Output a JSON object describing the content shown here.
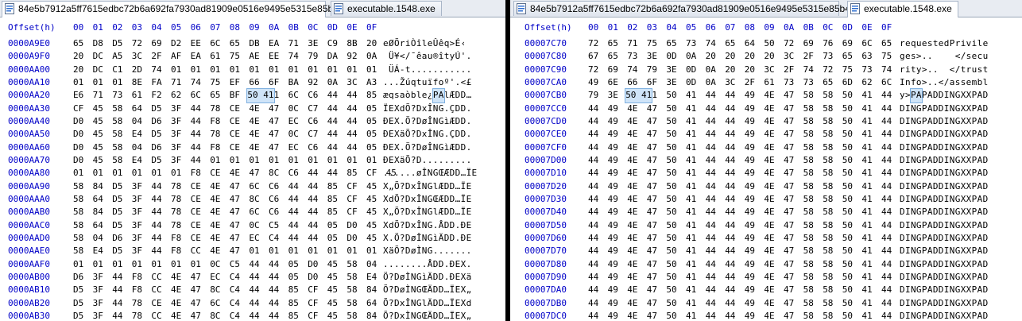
{
  "left": {
    "tabs": [
      {
        "label": "84e5b7912a5ff7615edbc72b6a692fa7930ad81909e0516e9495e5315e85b4bc",
        "icon": "hex-file-icon",
        "active": true
      },
      {
        "label": "executable.1548.exe",
        "icon": "hex-file-icon",
        "active": false
      }
    ],
    "header": {
      "offset_label": "Offset(h)",
      "cols": [
        "00",
        "01",
        "02",
        "03",
        "04",
        "05",
        "06",
        "07",
        "08",
        "09",
        "0A",
        "0B",
        "0C",
        "0D",
        "0E",
        "0F"
      ]
    },
    "rows": [
      {
        "off": "0000A9E0",
        "hex": "65 D8 D5 72 69 D2 EE 6C 65 DB EA 71 3E C9 8B 20",
        "asc": "eØÕriÒîleÛêq>É‹ "
      },
      {
        "off": "0000A9F0",
        "hex": "20 DC A5 3C 2F AF EA 61 75 AE EE 74 79 DA 92 0A",
        "asc": " Ü¥</¯êau®îtyÚ'."
      },
      {
        "off": "0000AA00",
        "hex": "20 DC C1 2D 74 01 01 01 01 01 01 01 01 01 01 01",
        "asc": " ÜÁ-t..........."
      },
      {
        "off": "0000AA10",
        "hex": "01 01 01 8E FA 71 74 75 EF 66 6F BA 92 0A 3C A3",
        "asc": "...Žúqtuïfoº'.<£"
      },
      {
        "off": "0000AA20",
        "hex": "E6 71 73 61 F2 62 6C 65 BF 50 41 6C C6 44 44 85",
        "asc": "æqsaòble¿PAlÆDD…"
      },
      {
        "off": "0000AA30",
        "hex": "CF 45 58 64 D5 3F 44 78 CE 4E 47 0C C7 44 44 05",
        "asc": "ÏEXdÕ?DxÎNG.ÇDD."
      },
      {
        "off": "0000AA40",
        "hex": "D0 45 58 04 D6 3F 44 F8 CE 4E 47 EC C6 44 44 05",
        "asc": "ÐEX.Ö?DøÎNGìÆDD."
      },
      {
        "off": "0000AA50",
        "hex": "D0 45 58 E4 D5 3F 44 78 CE 4E 47 0C C7 44 44 05",
        "asc": "ÐEXäÕ?DxÎNG.ÇDD."
      },
      {
        "off": "0000AA60",
        "hex": "D0 45 58 04 D6 3F 44 F8 CE 4E 47 EC C6 44 44 05",
        "asc": "ÐEX.Ö?DøÎNGìÆDD."
      },
      {
        "off": "0000AA70",
        "hex": "D0 45 58 E4 D5 3F 44 01 01 01 01 01 01 01 01 01",
        "asc": "ÐEXäÕ?D........."
      },
      {
        "off": "0000AA80",
        "hex": "01 01 01 01 01 01 F8 CE 4E 47 8C C6 44 44 85 CF 45",
        "asc": "......øÎNGŒÆDD…ÏE"
      },
      {
        "off": "0000AA90",
        "hex": "58 84 D5 3F 44 78 CE 4E 47 6C C6 44 44 85 CF 45",
        "asc": "X„Õ?DxÎNGlÆDD…ÏE"
      },
      {
        "off": "0000AAA0",
        "hex": "58 64 D5 3F 44 78 CE 4E 47 8C C6 44 44 85 CF 45",
        "asc": "XdÕ?DxÎNGŒÆDD…ÏE"
      },
      {
        "off": "0000AAB0",
        "hex": "58 84 D5 3F 44 78 CE 4E 47 6C C6 44 44 85 CF 45",
        "asc": "X„Õ?DxÎNGlÆDD…ÏE"
      },
      {
        "off": "0000AAC0",
        "hex": "58 64 D5 3F 44 78 CE 4E 47 0C C5 44 44 05 D0 45",
        "asc": "XdÕ?DxÎNG.ÅDD.ÐE"
      },
      {
        "off": "0000AAD0",
        "hex": "58 04 D6 3F 44 F8 CE 4E 47 EC C4 44 44 05 D0 45",
        "asc": "X.Ö?DøÎNGìÄDD.ÐE"
      },
      {
        "off": "0000AAE0",
        "hex": "58 E4 D5 3F 44 F8 CC 4E 47 01 01 01 01 01 01 01",
        "asc": "XäÕ?DøÌNG......."
      },
      {
        "off": "0000AAF0",
        "hex": "01 01 01 01 01 01 01 0C C5 44 44 05 D0 45 58 04",
        "asc": "........ÅDD.ÐEX."
      },
      {
        "off": "0000AB00",
        "hex": "D6 3F 44 F8 CC 4E 47 EC C4 44 44 05 D0 45 58 E4",
        "asc": "Ö?DøÌNGìÄDD.ÐEXä"
      },
      {
        "off": "0000AB10",
        "hex": "D5 3F 44 F8 CC 4E 47 8C C4 44 44 85 CF 45 58 84",
        "asc": "Õ?DøÌNGŒÄDD…ÏEX„"
      },
      {
        "off": "0000AB20",
        "hex": "D5 3F 44 78 CE 4E 47 6C C4 44 44 85 CF 45 58 64",
        "asc": "Õ?DxÎNGlÄDD…ÏEXd"
      },
      {
        "off": "0000AB30",
        "hex": "D5 3F 44 78 CC 4E 47 8C C4 44 44 85 CF 45 58 84",
        "asc": "Õ?DxÌNGŒÄDD…ÏEX„"
      }
    ]
  },
  "right": {
    "tabs": [
      {
        "label": "84e5b7912a5ff7615edbc72b6a692fa7930ad81909e0516e9495e5315e85b4bc",
        "icon": "hex-file-icon",
        "active": false
      },
      {
        "label": "executable.1548.exe",
        "icon": "hex-file-icon",
        "active": true
      }
    ],
    "header": {
      "offset_label": "Offset(h)",
      "cols": [
        "00",
        "01",
        "02",
        "03",
        "04",
        "05",
        "06",
        "07",
        "08",
        "09",
        "0A",
        "0B",
        "0C",
        "0D",
        "0E",
        "0F"
      ]
    },
    "rows": [
      {
        "off": "00007C70",
        "hex": "72 65 71 75 65 73 74 65 64 50 72 69 76 69 6C 65",
        "asc": "requestedPrivile"
      },
      {
        "off": "00007C80",
        "hex": "67 65 73 3E 0D 0A 20 20 20 20 3C 2F 73 65 63 75",
        "asc": "ges>..    </secu"
      },
      {
        "off": "00007C90",
        "hex": "72 69 74 79 3E 0D 0A 20 20 3C 2F 74 72 75 73 74",
        "asc": "rity>..  </trust"
      },
      {
        "off": "00007CA0",
        "hex": "49 6E 66 6F 3E 0D 0A 3C 2F 61 73 73 65 6D 62 6C",
        "asc": "Info>..</assembl"
      },
      {
        "off": "00007CB0",
        "hex": "79 3E 50 41 50 41 44 44 49 4E 47 58 58 50 41 44",
        "asc": "y>PAPADDINGXXPAD"
      },
      {
        "off": "00007CC0",
        "hex": "44 49 4E 47 50 41 44 44 49 4E 47 58 58 50 41 44",
        "asc": "DINGPADDINGXXPAD"
      },
      {
        "off": "00007CD0",
        "hex": "44 49 4E 47 50 41 44 44 49 4E 47 58 58 50 41 44",
        "asc": "DINGPADDINGXXPAD"
      },
      {
        "off": "00007CE0",
        "hex": "44 49 4E 47 50 41 44 44 49 4E 47 58 58 50 41 44",
        "asc": "DINGPADDINGXXPAD"
      },
      {
        "off": "00007CF0",
        "hex": "44 49 4E 47 50 41 44 44 49 4E 47 58 58 50 41 44",
        "asc": "DINGPADDINGXXPAD"
      },
      {
        "off": "00007D00",
        "hex": "44 49 4E 47 50 41 44 44 49 4E 47 58 58 50 41 44",
        "asc": "DINGPADDINGXXPAD"
      },
      {
        "off": "00007D10",
        "hex": "44 49 4E 47 50 41 44 44 49 4E 47 58 58 50 41 44",
        "asc": "DINGPADDINGXXPAD"
      },
      {
        "off": "00007D20",
        "hex": "44 49 4E 47 50 41 44 44 49 4E 47 58 58 50 41 44",
        "asc": "DINGPADDINGXXPAD"
      },
      {
        "off": "00007D30",
        "hex": "44 49 4E 47 50 41 44 44 49 4E 47 58 58 50 41 44",
        "asc": "DINGPADDINGXXPAD"
      },
      {
        "off": "00007D40",
        "hex": "44 49 4E 47 50 41 44 44 49 4E 47 58 58 50 41 44",
        "asc": "DINGPADDINGXXPAD"
      },
      {
        "off": "00007D50",
        "hex": "44 49 4E 47 50 41 44 44 49 4E 47 58 58 50 41 44",
        "asc": "DINGPADDINGXXPAD"
      },
      {
        "off": "00007D60",
        "hex": "44 49 4E 47 50 41 44 44 49 4E 47 58 58 50 41 44",
        "asc": "DINGPADDINGXXPAD"
      },
      {
        "off": "00007D70",
        "hex": "44 49 4E 47 50 41 44 44 49 4E 47 58 58 50 41 44",
        "asc": "DINGPADDINGXXPAD"
      },
      {
        "off": "00007D80",
        "hex": "44 49 4E 47 50 41 44 44 49 4E 47 58 58 50 41 44",
        "asc": "DINGPADDINGXXPAD"
      },
      {
        "off": "00007D90",
        "hex": "44 49 4E 47 50 41 44 44 49 4E 47 58 58 50 41 44",
        "asc": "DINGPADDINGXXPAD"
      },
      {
        "off": "00007DA0",
        "hex": "44 49 4E 47 50 41 44 44 49 4E 47 58 58 50 41 44",
        "asc": "DINGPADDINGXXPAD"
      },
      {
        "off": "00007DB0",
        "hex": "44 49 4E 47 50 41 44 44 49 4E 47 58 58 50 41 44",
        "asc": "DINGPADDINGXXPAD"
      },
      {
        "off": "00007DC0",
        "hex": "44 49 4E 47 50 41 44 44 49 4E 47 58 58 50 41 44",
        "asc": "DINGPADDINGXXPAD"
      }
    ]
  },
  "selection": {
    "hex": "50 41",
    "ascii": "PA",
    "color": "#cfe4f8"
  },
  "colors": {
    "offset": "#0000c8",
    "header": "#0000c8",
    "data": "#000000",
    "divider": "#000000",
    "tabbar": "#e8ecf2"
  }
}
